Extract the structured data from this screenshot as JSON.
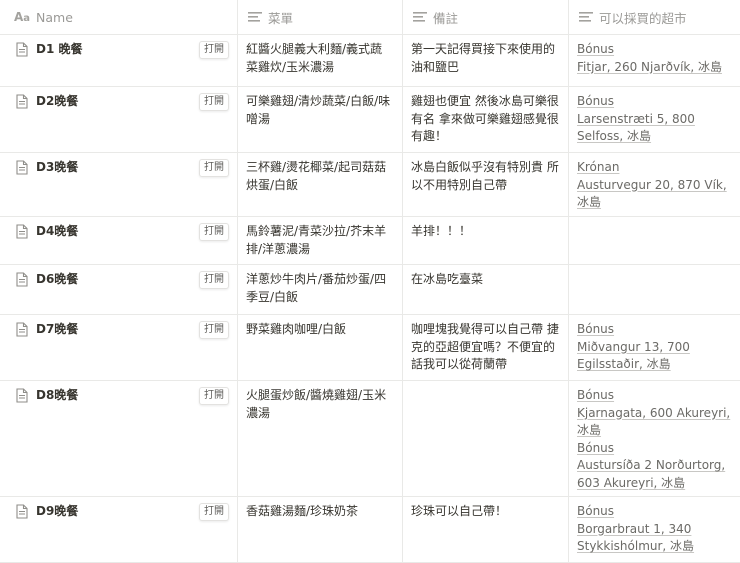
{
  "columns": [
    {
      "key": "name",
      "label": "Name",
      "icon": "text-aa-icon"
    },
    {
      "key": "menu",
      "label": "菜單",
      "icon": "lines-icon"
    },
    {
      "key": "note",
      "label": "備註",
      "icon": "lines-icon"
    },
    {
      "key": "shop",
      "label": "可以採買的超市",
      "icon": "lines-icon"
    }
  ],
  "open_label": "打開",
  "rows": [
    {
      "name": "D1 晚餐",
      "menu": "紅醬火腿義大利麵/義式蔬菜雞炊/玉米濃湯",
      "note": "第一天記得買接下來使用的油和鹽巴",
      "shop": [
        "Bónus",
        "Fitjar, 260 Njarðvík, 冰島"
      ]
    },
    {
      "name": "D2晚餐",
      "menu": "可樂雞翅/清炒蔬菜/白飯/味噌湯",
      "note": "雞翅也便宜 然後冰島可樂很有名 拿來做可樂雞翅感覺很有趣！",
      "shop": [
        "Bónus",
        "Larsenstræti 5, 800 Selfoss, 冰島"
      ]
    },
    {
      "name": "D3晚餐",
      "menu": "三杯雞/燙花椰菜/起司菇菇烘蛋/白飯",
      "note": "冰島白飯似乎沒有特別貴 所以不用特別自己帶",
      "shop": [
        "Krónan",
        "Austurvegur 20, 870 Vík, 冰島"
      ]
    },
    {
      "name": "D4晚餐",
      "menu": "馬鈴薯泥/青菜沙拉/芥末羊排/洋蔥濃湯",
      "note": "羊排！！！",
      "shop": []
    },
    {
      "name": "D6晚餐",
      "menu": "洋蔥炒牛肉片/番茄炒蛋/四季豆/白飯",
      "note": "在冰島吃臺菜",
      "shop": []
    },
    {
      "name": "D7晚餐",
      "menu": "野菜雞肉咖哩/白飯",
      "note": "咖哩塊我覺得可以自己帶 捷克的亞超便宜嗎？不便宜的話我可以從荷蘭帶",
      "shop": [
        "Bónus",
        "Miðvangur 13, 700 Egilsstaðir, 冰島"
      ]
    },
    {
      "name": "D8晚餐",
      "menu": "火腿蛋炒飯/醬燒雞翅/玉米濃湯",
      "note": "",
      "shop": [
        "Bónus",
        "Kjarnagata, 600 Akureyri, 冰島",
        "Bónus",
        "Austursíða 2 Norðurtorg, 603 Akureyri, 冰島"
      ]
    },
    {
      "name": "D9晚餐",
      "menu": "香菇雞湯麵/珍珠奶茶",
      "note": "珍珠可以自己帶！",
      "shop": [
        "Bónus",
        "Borgarbraut 1, 340 Stykkishólmur, 冰島"
      ]
    }
  ]
}
